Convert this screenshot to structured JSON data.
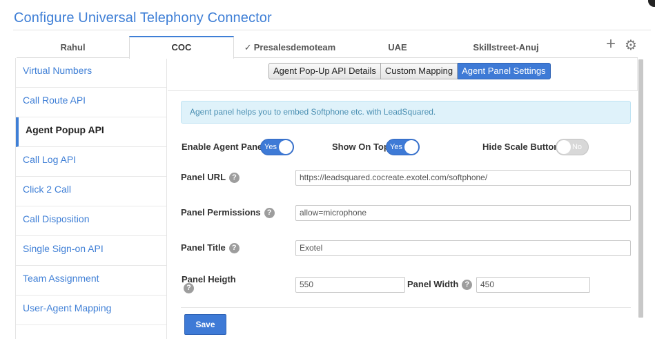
{
  "header": {
    "title": "Configure Universal Telephony Connector"
  },
  "tabs": [
    {
      "label": "Rahul",
      "check": ""
    },
    {
      "label": "COC",
      "check": ""
    },
    {
      "label": "Presalesdemoteam",
      "check": "✓"
    },
    {
      "label": "UAE",
      "check": ""
    },
    {
      "label": "Skillstreet-Anuj",
      "check": ""
    }
  ],
  "tab_actions": {
    "add_icon": "+",
    "settings_icon": "⚙"
  },
  "sidebar": {
    "items": [
      {
        "label": "Virtual Numbers"
      },
      {
        "label": "Call Route API"
      },
      {
        "label": "Agent Popup API"
      },
      {
        "label": "Call Log API"
      },
      {
        "label": "Click 2 Call"
      },
      {
        "label": "Call Disposition"
      },
      {
        "label": "Single Sign-on API"
      },
      {
        "label": "Team Assignment"
      },
      {
        "label": "User-Agent Mapping"
      }
    ]
  },
  "subtabs": [
    {
      "label": "Agent Pop-Up API Details"
    },
    {
      "label": "Custom Mapping"
    },
    {
      "label": "Agent Panel Settings"
    }
  ],
  "info": {
    "text": "Agent panel helps you to embed Softphone etc. with LeadSquared."
  },
  "toggles": {
    "enable_agent_panel": {
      "label": "Enable Agent Panel",
      "value": "Yes"
    },
    "show_on_top": {
      "label": "Show On Top",
      "value": "Yes"
    },
    "hide_scale_button": {
      "label": "Hide Scale Button",
      "value": "No"
    }
  },
  "fields": {
    "panel_url": {
      "label": "Panel URL",
      "value": "https://leadsquared.cocreate.exotel.com/softphone/"
    },
    "panel_permissions": {
      "label": "Panel Permissions",
      "value": "allow=microphone"
    },
    "panel_title": {
      "label": "Panel Title",
      "value": "Exotel"
    },
    "panel_height": {
      "label": "Panel Heigth",
      "value": "550"
    },
    "panel_width": {
      "label": "Panel Width",
      "value": "450"
    }
  },
  "help_icon": "?",
  "actions": {
    "save_label": "Save"
  },
  "colors": {
    "accent": "#3e7ad6",
    "title": "#3f7fd6",
    "info_bg": "#dff2fa",
    "info_text": "#4a8fb2"
  }
}
